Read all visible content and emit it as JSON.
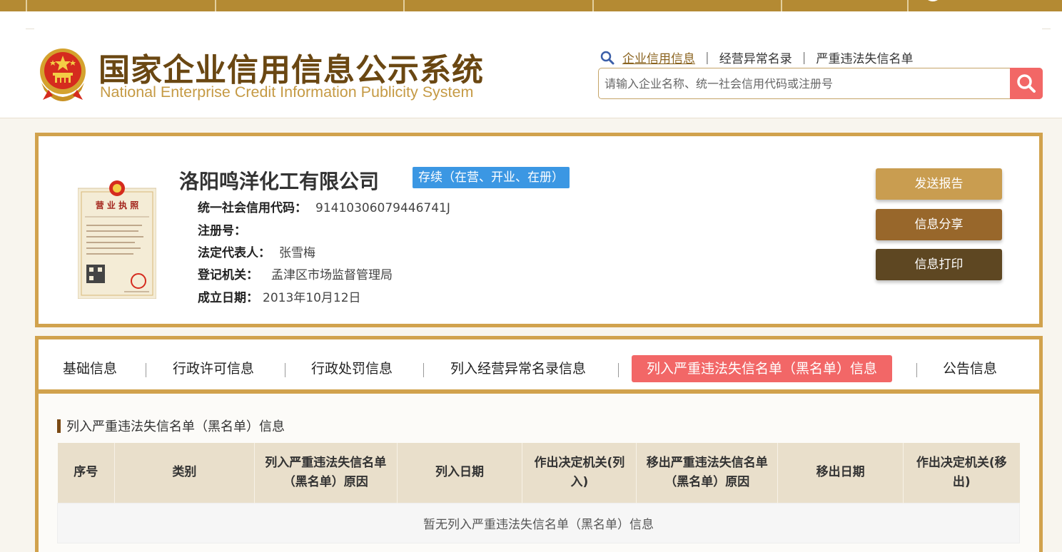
{
  "header": {
    "title_cn": "国家企业信用信息公示系统",
    "title_en": "National Enterprise Credit Information Publicity System",
    "search_links": [
      "企业信用信息",
      "经营异常名录",
      "严重违法失信名单"
    ],
    "search_placeholder": "请输入企业名称、统一社会信用代码或注册号"
  },
  "company": {
    "name": "洛阳鸣洋化工有限公司",
    "status": "存续（在营、开业、在册）",
    "fields": [
      {
        "label": "统一社会信用代码：",
        "value": "91410306079446741J"
      },
      {
        "label": "注册号：",
        "value": ""
      },
      {
        "label": "法定代表人：",
        "value": "张雪梅"
      },
      {
        "label": "登记机关：",
        "value": "孟津区市场监督管理局"
      },
      {
        "label": "成立日期：",
        "value": "2013年10月12日"
      }
    ],
    "license_title": "营业执照"
  },
  "actions": {
    "send_report": "发送报告",
    "share": "信息分享",
    "print": "信息打印"
  },
  "tabs": [
    "基础信息",
    "行政许可信息",
    "行政处罚信息",
    "列入经营异常名录信息",
    "列入严重违法失信名单（黑名单）信息",
    "公告信息"
  ],
  "section": {
    "title": "列入严重违法失信名单（黑名单）信息",
    "columns": [
      "序号",
      "类别",
      "列入严重违法失信名单（黑名单）原因",
      "列入日期",
      "作出决定机关(列入)",
      "移出严重违法失信名单（黑名单）原因",
      "移出日期",
      "作出决定机关(移出)"
    ],
    "empty_text": "暂无列入严重违法失信名单（黑名单）信息"
  },
  "colors": {
    "gold": "#d1a24d",
    "brown_title": "#6a4712",
    "active_tab": "#f26767",
    "status_blue": "#3b97e3"
  },
  "icons": [
    "magnifier-icon",
    "search-icon",
    "national-emblem",
    "business-license-image"
  ]
}
